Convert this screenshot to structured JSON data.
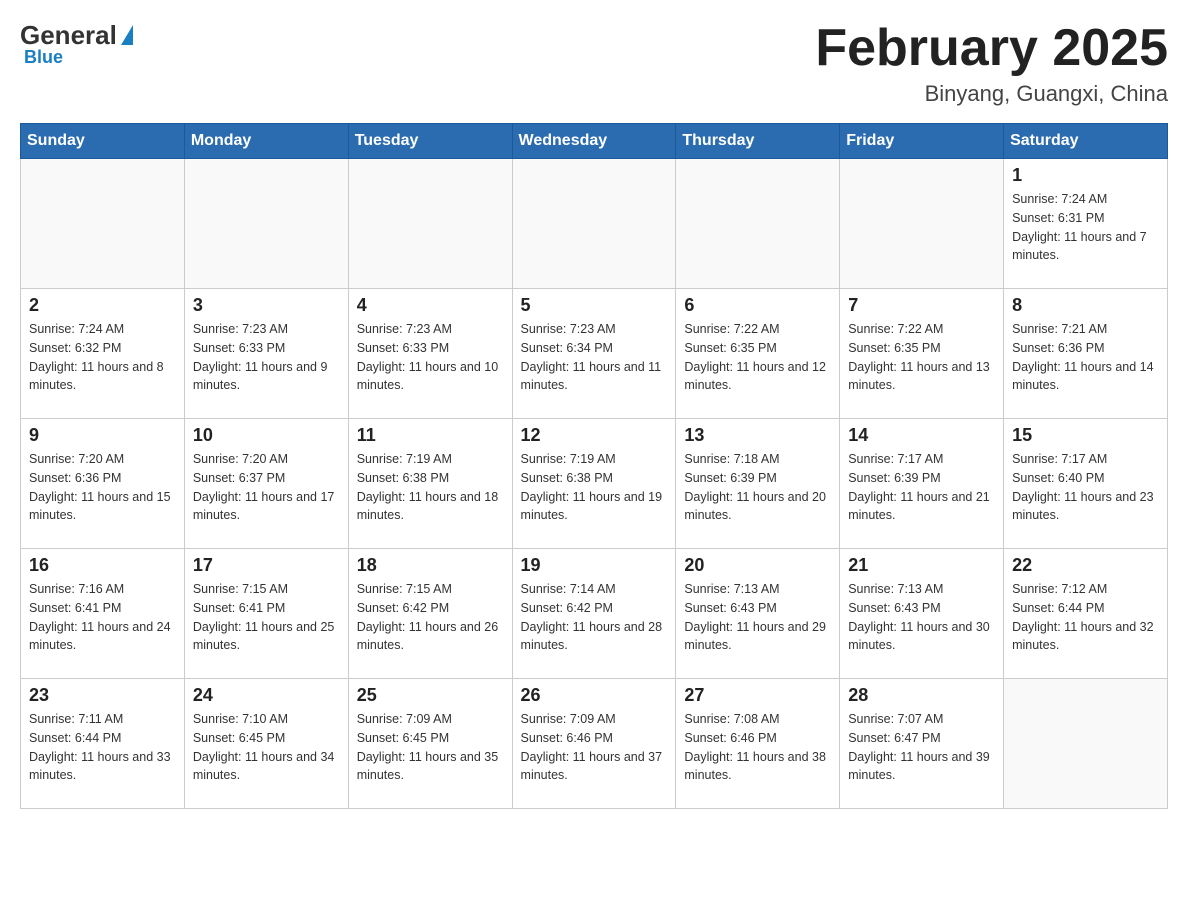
{
  "header": {
    "logo_general": "General",
    "logo_blue": "Blue",
    "month_title": "February 2025",
    "location": "Binyang, Guangxi, China"
  },
  "weekdays": [
    "Sunday",
    "Monday",
    "Tuesday",
    "Wednesday",
    "Thursday",
    "Friday",
    "Saturday"
  ],
  "weeks": [
    [
      {
        "day": "",
        "info": ""
      },
      {
        "day": "",
        "info": ""
      },
      {
        "day": "",
        "info": ""
      },
      {
        "day": "",
        "info": ""
      },
      {
        "day": "",
        "info": ""
      },
      {
        "day": "",
        "info": ""
      },
      {
        "day": "1",
        "info": "Sunrise: 7:24 AM\nSunset: 6:31 PM\nDaylight: 11 hours and 7 minutes."
      }
    ],
    [
      {
        "day": "2",
        "info": "Sunrise: 7:24 AM\nSunset: 6:32 PM\nDaylight: 11 hours and 8 minutes."
      },
      {
        "day": "3",
        "info": "Sunrise: 7:23 AM\nSunset: 6:33 PM\nDaylight: 11 hours and 9 minutes."
      },
      {
        "day": "4",
        "info": "Sunrise: 7:23 AM\nSunset: 6:33 PM\nDaylight: 11 hours and 10 minutes."
      },
      {
        "day": "5",
        "info": "Sunrise: 7:23 AM\nSunset: 6:34 PM\nDaylight: 11 hours and 11 minutes."
      },
      {
        "day": "6",
        "info": "Sunrise: 7:22 AM\nSunset: 6:35 PM\nDaylight: 11 hours and 12 minutes."
      },
      {
        "day": "7",
        "info": "Sunrise: 7:22 AM\nSunset: 6:35 PM\nDaylight: 11 hours and 13 minutes."
      },
      {
        "day": "8",
        "info": "Sunrise: 7:21 AM\nSunset: 6:36 PM\nDaylight: 11 hours and 14 minutes."
      }
    ],
    [
      {
        "day": "9",
        "info": "Sunrise: 7:20 AM\nSunset: 6:36 PM\nDaylight: 11 hours and 15 minutes."
      },
      {
        "day": "10",
        "info": "Sunrise: 7:20 AM\nSunset: 6:37 PM\nDaylight: 11 hours and 17 minutes."
      },
      {
        "day": "11",
        "info": "Sunrise: 7:19 AM\nSunset: 6:38 PM\nDaylight: 11 hours and 18 minutes."
      },
      {
        "day": "12",
        "info": "Sunrise: 7:19 AM\nSunset: 6:38 PM\nDaylight: 11 hours and 19 minutes."
      },
      {
        "day": "13",
        "info": "Sunrise: 7:18 AM\nSunset: 6:39 PM\nDaylight: 11 hours and 20 minutes."
      },
      {
        "day": "14",
        "info": "Sunrise: 7:17 AM\nSunset: 6:39 PM\nDaylight: 11 hours and 21 minutes."
      },
      {
        "day": "15",
        "info": "Sunrise: 7:17 AM\nSunset: 6:40 PM\nDaylight: 11 hours and 23 minutes."
      }
    ],
    [
      {
        "day": "16",
        "info": "Sunrise: 7:16 AM\nSunset: 6:41 PM\nDaylight: 11 hours and 24 minutes."
      },
      {
        "day": "17",
        "info": "Sunrise: 7:15 AM\nSunset: 6:41 PM\nDaylight: 11 hours and 25 minutes."
      },
      {
        "day": "18",
        "info": "Sunrise: 7:15 AM\nSunset: 6:42 PM\nDaylight: 11 hours and 26 minutes."
      },
      {
        "day": "19",
        "info": "Sunrise: 7:14 AM\nSunset: 6:42 PM\nDaylight: 11 hours and 28 minutes."
      },
      {
        "day": "20",
        "info": "Sunrise: 7:13 AM\nSunset: 6:43 PM\nDaylight: 11 hours and 29 minutes."
      },
      {
        "day": "21",
        "info": "Sunrise: 7:13 AM\nSunset: 6:43 PM\nDaylight: 11 hours and 30 minutes."
      },
      {
        "day": "22",
        "info": "Sunrise: 7:12 AM\nSunset: 6:44 PM\nDaylight: 11 hours and 32 minutes."
      }
    ],
    [
      {
        "day": "23",
        "info": "Sunrise: 7:11 AM\nSunset: 6:44 PM\nDaylight: 11 hours and 33 minutes."
      },
      {
        "day": "24",
        "info": "Sunrise: 7:10 AM\nSunset: 6:45 PM\nDaylight: 11 hours and 34 minutes."
      },
      {
        "day": "25",
        "info": "Sunrise: 7:09 AM\nSunset: 6:45 PM\nDaylight: 11 hours and 35 minutes."
      },
      {
        "day": "26",
        "info": "Sunrise: 7:09 AM\nSunset: 6:46 PM\nDaylight: 11 hours and 37 minutes."
      },
      {
        "day": "27",
        "info": "Sunrise: 7:08 AM\nSunset: 6:46 PM\nDaylight: 11 hours and 38 minutes."
      },
      {
        "day": "28",
        "info": "Sunrise: 7:07 AM\nSunset: 6:47 PM\nDaylight: 11 hours and 39 minutes."
      },
      {
        "day": "",
        "info": ""
      }
    ]
  ]
}
